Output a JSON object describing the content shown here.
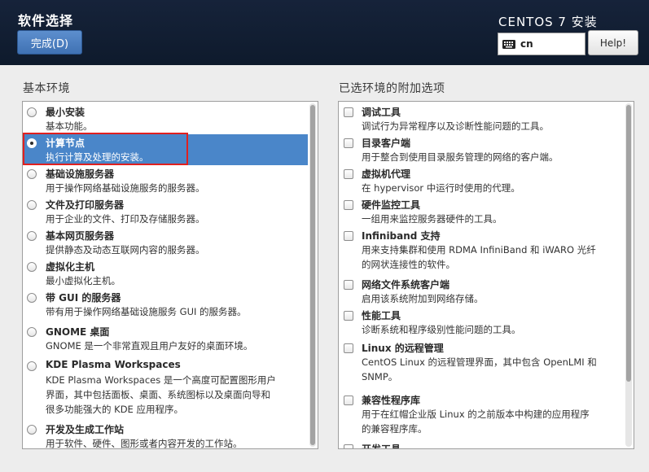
{
  "header": {
    "title": "软件选择",
    "done_label": "完成(D)",
    "product": "CENTOS 7 安装",
    "keyboard_layout": "cn",
    "help_label": "Help!"
  },
  "base_env": {
    "heading": "基本环境",
    "selected_index": 1,
    "items": [
      {
        "name": "最小安装",
        "desc": "基本功能。"
      },
      {
        "name": "计算节点",
        "desc": "执行计算及处理的安装。"
      },
      {
        "name": "基础设施服务器",
        "desc": "用于操作网络基础设施服务的服务器。"
      },
      {
        "name": "文件及打印服务器",
        "desc": "用于企业的文件、打印及存储服务器。"
      },
      {
        "name": "基本网页服务器",
        "desc": "提供静态及动态互联网内容的服务器。"
      },
      {
        "name": "虚拟化主机",
        "desc": "最小虚拟化主机。"
      },
      {
        "name": "带 GUI 的服务器",
        "desc": "带有用于操作网络基础设施服务 GUI 的服务器。"
      },
      {
        "name": "GNOME 桌面",
        "desc": "GNOME 是一个非常直观且用户友好的桌面环境。"
      },
      {
        "name": "KDE Plasma Workspaces",
        "desc": [
          "KDE Plasma Workspaces 是一个高度可配置图形用户",
          "界面，其中包括面板、桌面、系统图标以及桌面向导和",
          "很多功能强大的 KDE 应用程序。"
        ]
      },
      {
        "name": "开发及生成工作站",
        "desc": "用于软件、硬件、图形或者内容开发的工作站。"
      }
    ]
  },
  "addons": {
    "heading": "已选环境的附加选项",
    "items": [
      {
        "name": "调试工具",
        "desc": "调试行为异常程序以及诊断性能问题的工具。"
      },
      {
        "name": "目录客户端",
        "desc": "用于整合到使用目录服务管理的网络的客户端。"
      },
      {
        "name": "虚拟机代理",
        "desc": "在 hypervisor 中运行时使用的代理。"
      },
      {
        "name": "硬件监控工具",
        "desc": "一组用来监控服务器硬件的工具。"
      },
      {
        "name": "Infiniband 支持",
        "desc": [
          "用来支持集群和使用 RDMA InfiniBand 和 iWARO 光纤",
          "的网状连接性的软件。"
        ]
      },
      {
        "name": "网络文件系统客户端",
        "desc": "启用该系统附加到网络存储。"
      },
      {
        "name": "性能工具",
        "desc": "诊断系统和程序级别性能问题的工具。"
      },
      {
        "name": "Linux 的远程管理",
        "desc": [
          "CentOS Linux 的远程管理界面，其中包含 OpenLMI 和",
          "SNMP。"
        ]
      },
      {
        "name": "兼容性程序库",
        "desc": [
          "用于在红帽企业版 Linux 的之前版本中构建的应用程序",
          "的兼容程序库。"
        ]
      },
      {
        "name": "开发工具",
        "desc": ""
      }
    ]
  }
}
